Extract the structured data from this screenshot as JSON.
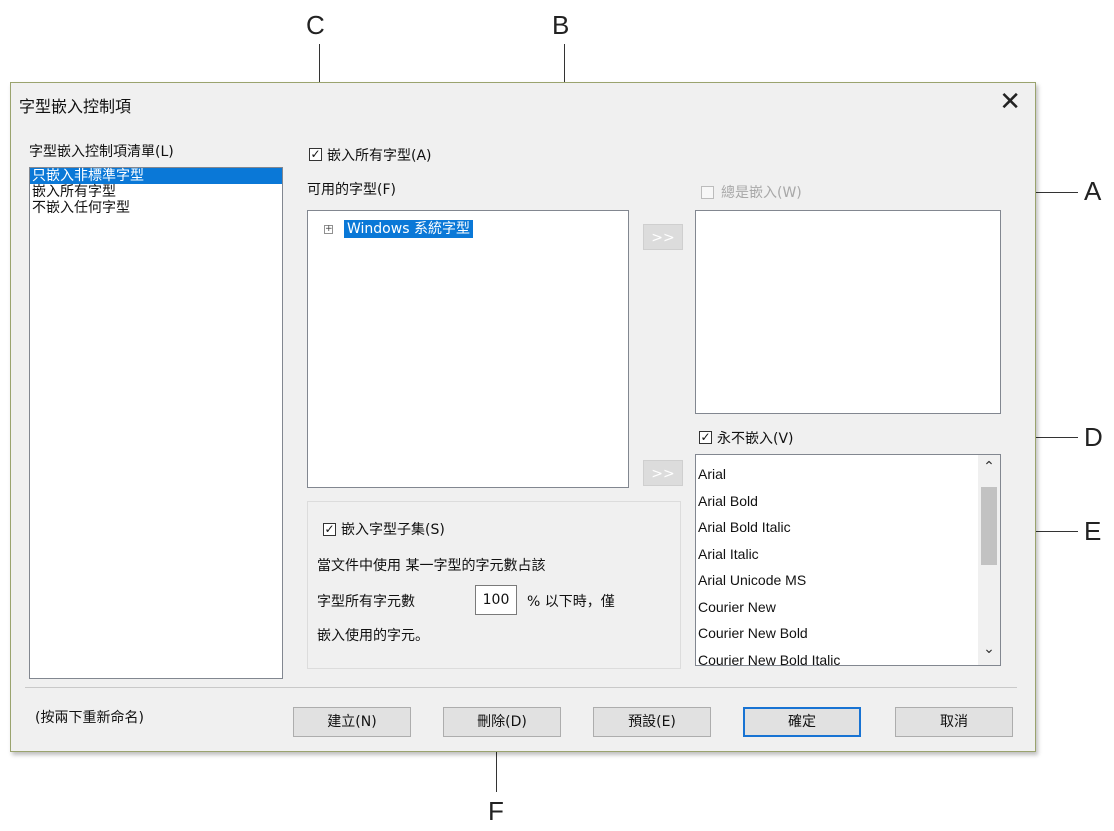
{
  "callouts": {
    "A": "A",
    "B": "B",
    "C": "C",
    "D": "D",
    "E": "E",
    "F": "F"
  },
  "dialog": {
    "title": "字型嵌入控制項",
    "close_label": "✕",
    "control_list_label": "字型嵌入控制項清單(L)",
    "control_list_items": [
      "只嵌入非標準字型",
      "嵌入所有字型",
      "不嵌入任何字型"
    ],
    "embed_all_label": "嵌入所有字型(A)",
    "available_fonts_label": "可用的字型(F)",
    "tree_item": "Windows 系統字型",
    "add_always_button": ">>",
    "add_never_button": ">>",
    "always_embed_label": "總是嵌入(W)",
    "never_embed_label": "永不嵌入(V)",
    "never_embed_fonts": [
      "Arial",
      "Arial Bold",
      "Arial Bold Italic",
      "Arial Italic",
      "Arial Unicode MS",
      "Courier New",
      "Courier New Bold",
      "Courier New Bold Italic"
    ],
    "subset_label": "嵌入字型子集(S)",
    "subset_text_1": "當文件中使用 某一字型的字元數占該",
    "subset_text_2a": "字型所有字元數",
    "subset_value": "100",
    "subset_text_2b": "% 以下時，僅",
    "subset_text_3": "嵌入使用的字元。",
    "rename_hint": "(按兩下重新命名)",
    "buttons": {
      "create": "建立(N)",
      "delete": "刪除(D)",
      "default": "預設(E)",
      "ok": "確定",
      "cancel": "取消"
    }
  }
}
